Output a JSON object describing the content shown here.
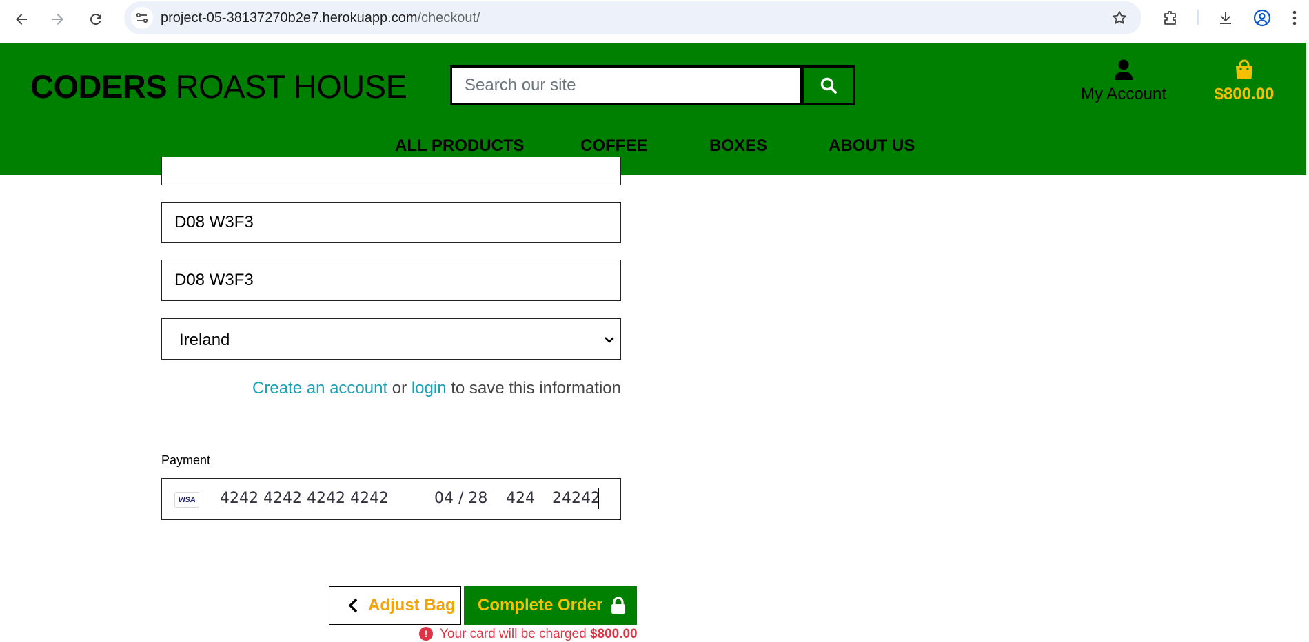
{
  "browser": {
    "url_host": "project-05-38137270b2e7.herokuapp.com",
    "url_path": "/checkout/"
  },
  "header": {
    "brand_bold": "CODERS",
    "brand_rest": " ROAST HOUSE",
    "search_placeholder": "Search our site",
    "account_label": "My Account",
    "bag_total": "$800.00",
    "nav": [
      "ALL PRODUCTS",
      "COFFEE",
      "BOXES",
      "ABOUT US"
    ]
  },
  "form": {
    "postcode": "D08 W3F3",
    "county": "D08 W3F3",
    "country": "Ireland",
    "save_info": {
      "create_account": "Create an account",
      "or": " or ",
      "login": "login",
      "suffix": " to save this information"
    },
    "payment_label": "Payment",
    "card": {
      "brand": "VISA",
      "number": "4242 4242 4242 4242",
      "expiry": "04 / 28",
      "cvc": "424",
      "postal": "24242"
    }
  },
  "actions": {
    "adjust_label": "Adjust Bag",
    "complete_label": "Complete Order",
    "charge_prefix": "Your card will be charged ",
    "charge_amount": "$800.00"
  },
  "colors": {
    "header_bg": "#008000",
    "accent_yellow": "#f5c000",
    "link": "#17a2b8",
    "error": "#dc3545"
  },
  "icons": [
    "back-icon",
    "forward-icon",
    "reload-icon",
    "site-info-icon",
    "bookmark-star-icon",
    "extensions-icon",
    "download-icon",
    "profile-icon",
    "more-menu-icon",
    "search-icon",
    "user-icon",
    "shopping-bag-icon",
    "chevron-down-icon",
    "chevron-left-icon",
    "lock-icon",
    "error-icon"
  ]
}
